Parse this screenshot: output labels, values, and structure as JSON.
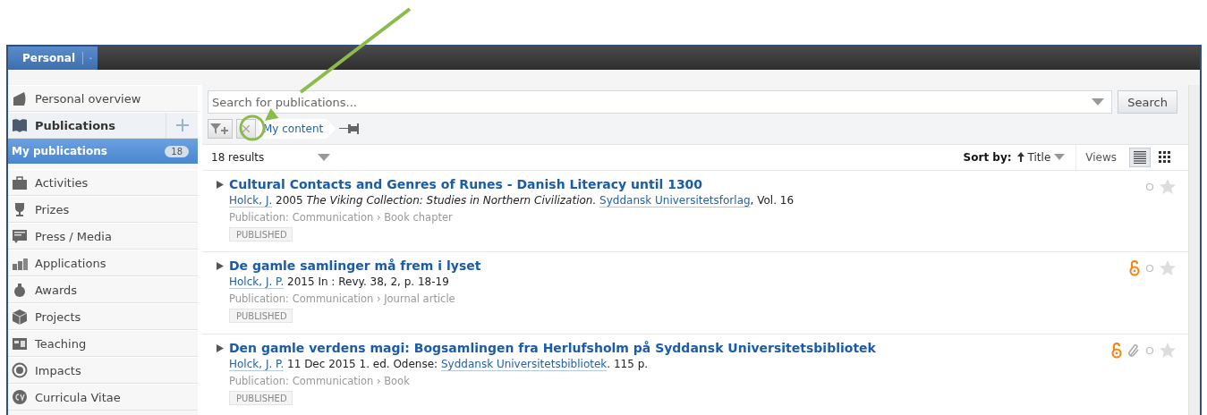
{
  "top_bar": {
    "tab": {
      "label": "Personal"
    }
  },
  "sidebar": {
    "items": [
      {
        "kind": "link",
        "label": "Personal overview",
        "selected": false
      },
      {
        "kind": "section",
        "label": "Publications",
        "selected": false
      },
      {
        "kind": "subitem",
        "label": "My publications",
        "count": "18",
        "selected": true
      },
      {
        "kind": "link",
        "label": "Activities",
        "selected": false
      },
      {
        "kind": "link",
        "label": "Prizes",
        "selected": false
      },
      {
        "kind": "link",
        "label": "Press / Media",
        "selected": false
      },
      {
        "kind": "link",
        "label": "Applications",
        "selected": false
      },
      {
        "kind": "link",
        "label": "Awards",
        "selected": false
      },
      {
        "kind": "link",
        "label": "Projects",
        "selected": false
      },
      {
        "kind": "link",
        "label": "Teaching",
        "selected": false
      },
      {
        "kind": "link",
        "label": "Impacts",
        "selected": false
      },
      {
        "kind": "link",
        "label": "Curricula Vitae",
        "selected": false
      }
    ]
  },
  "search": {
    "placeholder": "Search for publications...",
    "button": "Search"
  },
  "filter": {
    "chip": "My content"
  },
  "results": {
    "count": "18 results",
    "sort_label": "Sort by:",
    "sort_value": "Title",
    "views_label": "Views",
    "views": [
      {
        "kind": "list",
        "selected": true
      },
      {
        "kind": "grid",
        "selected": false
      }
    ]
  },
  "publications": [
    {
      "title": "Cultural Contacts and Genres of Runes - Danish Literacy until 1300",
      "citation": [
        {
          "kind": "link",
          "text": "Holck, J."
        },
        {
          "kind": "text",
          "text": " 2005 *The Viking Collection: Studies in Northern Civilization.* "
        },
        {
          "kind": "link",
          "text": "Syddansk Universitetsforlag"
        },
        {
          "kind": "text",
          "text": ", Vol. 16"
        }
      ],
      "type": "Publication: Communication › Book chapter",
      "status": "PUBLISHED",
      "open_access": false,
      "attachment": false,
      "starred": false
    },
    {
      "title": "De gamle samlinger må frem i lyset",
      "citation": [
        {
          "kind": "link",
          "text": "Holck, J. P."
        },
        {
          "kind": "text",
          "text": " 2015 In : Revy. 38, 2, p. 18-19"
        }
      ],
      "type": "Publication: Communication › Journal article",
      "status": "PUBLISHED",
      "open_access": true,
      "attachment": false,
      "starred": false
    },
    {
      "title": "Den gamle verdens magi: Bogsamlingen fra Herlufsholm på Syddansk Universitetsbibliotek",
      "citation": [
        {
          "kind": "link",
          "text": "Holck, J. P."
        },
        {
          "kind": "text",
          "text": " 11 Dec 2015 1. ed. Odense: "
        },
        {
          "kind": "link",
          "text": "Syddansk Universitetsbibliotek"
        },
        {
          "kind": "text",
          "text": ". 115 p."
        }
      ],
      "type": "Publication: Communication › Book",
      "status": "PUBLISHED",
      "open_access": true,
      "attachment": true,
      "starred": false
    }
  ]
}
